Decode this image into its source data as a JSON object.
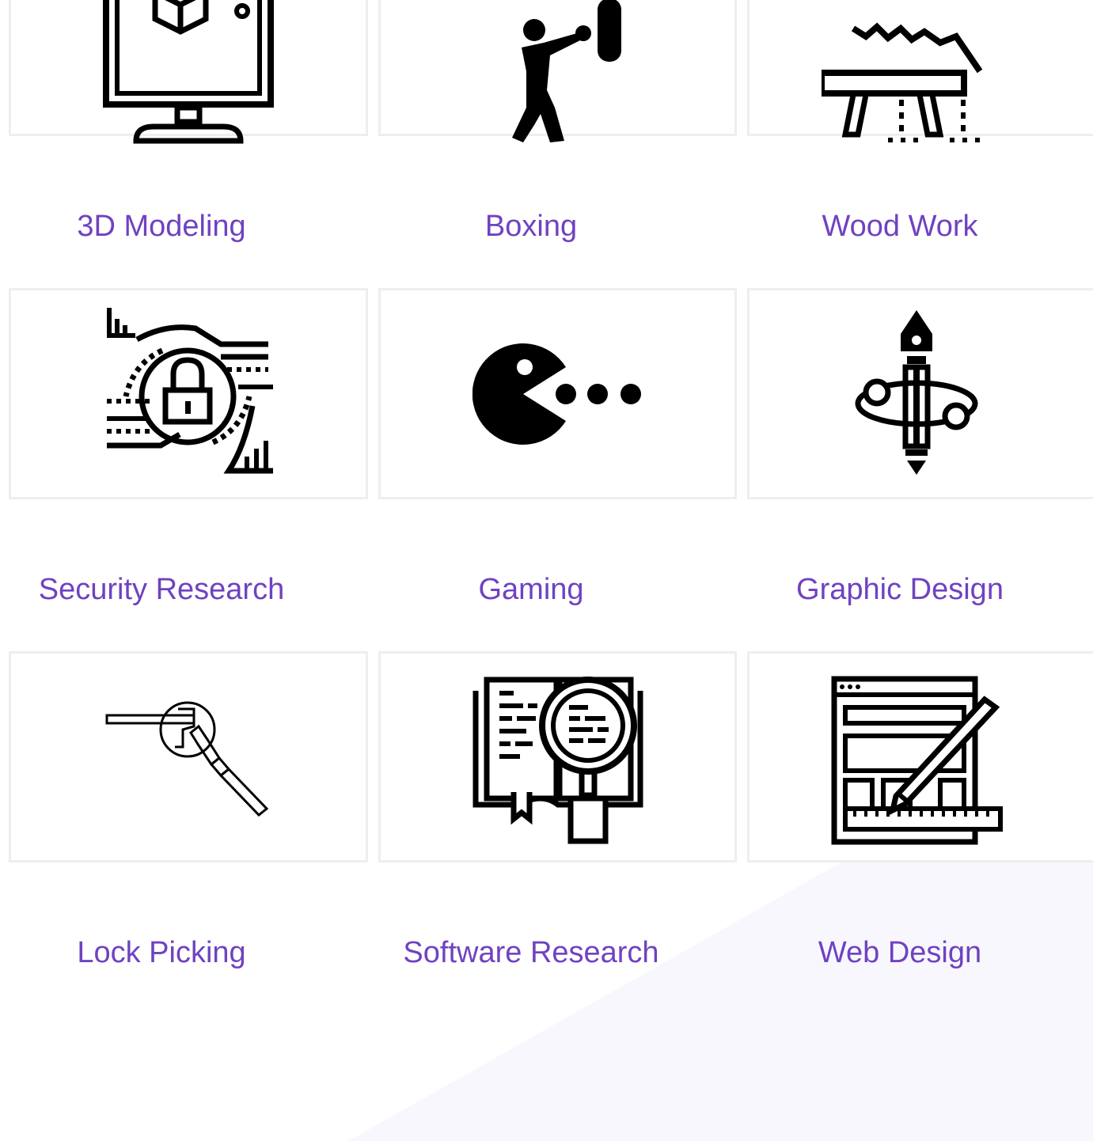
{
  "theme": {
    "accent": "#6f42c1",
    "card_border": "#eeeeee",
    "background": "#ffffff",
    "background_wedge": "#f8f7fd"
  },
  "items": [
    {
      "label": "3D Modeling",
      "icon": "3d-modeling-monitor-icon"
    },
    {
      "label": "Boxing",
      "icon": "boxing-icon"
    },
    {
      "label": "Wood Work",
      "icon": "wood-work-saw-icon"
    },
    {
      "label": "Security Research",
      "icon": "security-lock-circuit-icon"
    },
    {
      "label": "Gaming",
      "icon": "pacman-gaming-icon"
    },
    {
      "label": "Graphic Design",
      "icon": "pen-nib-design-icon"
    },
    {
      "label": "Lock Picking",
      "icon": "lock-picking-tools-icon"
    },
    {
      "label": "Software Research",
      "icon": "magnifier-book-research-icon"
    },
    {
      "label": "Web Design",
      "icon": "web-layout-pencil-icon"
    }
  ]
}
